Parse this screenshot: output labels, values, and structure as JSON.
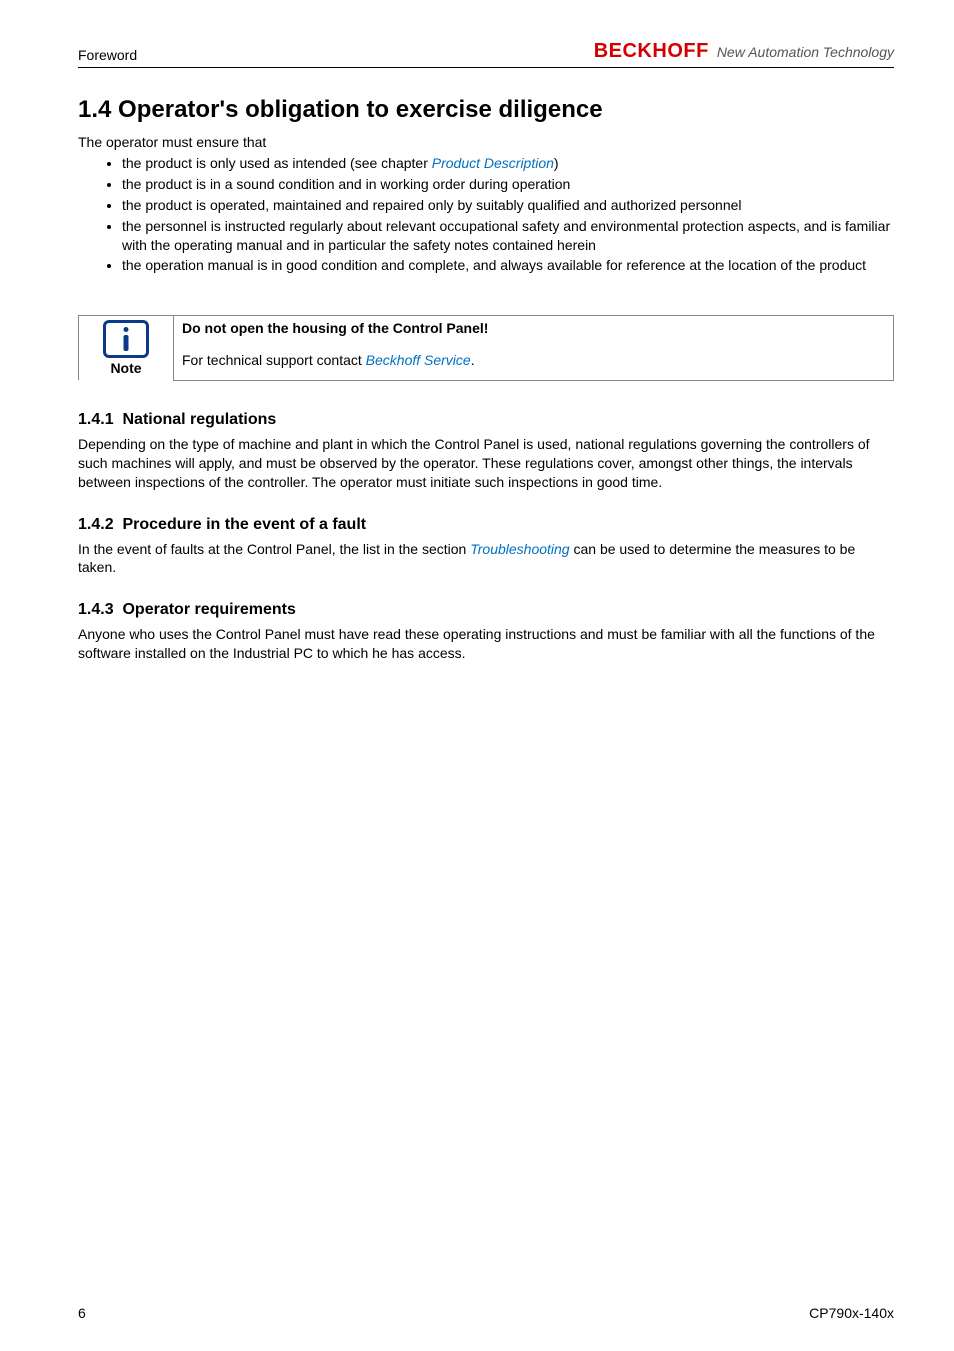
{
  "header": {
    "left": "Foreword",
    "logo": "BECKHOFF",
    "tagline": "New Automation Technology"
  },
  "section": {
    "number": "1.4",
    "title": "Operator's obligation to exercise diligence",
    "intro": "The operator must ensure that",
    "bullets": [
      {
        "pre": "the product is only used as intended (see chapter ",
        "link": "Product Description",
        "post": ")"
      },
      {
        "pre": "the product is in a sound condition and in working order during operation",
        "link": "",
        "post": ""
      },
      {
        "pre": "the product is operated, maintained and repaired only by suitably qualified and authorized personnel",
        "link": "",
        "post": ""
      },
      {
        "pre": "the personnel is instructed regularly about relevant occupational safety and environmental protection aspects, and is familiar with the operating manual and in particular the safety notes contained herein",
        "link": "",
        "post": ""
      },
      {
        "pre": "the operation manual is in good condition and complete, and always available for reference at the location of the product",
        "link": "",
        "post": ""
      }
    ]
  },
  "note": {
    "label": "Note",
    "title": "Do not open the housing of the Control Panel!",
    "body_pre": "For technical support contact ",
    "body_link": "Beckhoff Service",
    "body_post": "."
  },
  "sub1": {
    "num": "1.4.1",
    "title": "National regulations",
    "body": "Depending on the type of machine and plant in which the Control Panel is used, national regulations governing the controllers of such machines will apply, and must be observed by the operator. These regulations cover, amongst other things, the intervals between inspections of the controller. The operator must initiate such inspections in good time."
  },
  "sub2": {
    "num": "1.4.2",
    "title": "Procedure in the event of a fault",
    "body_pre": "In the event of faults at the Control Panel, the list in the section ",
    "body_link": "Troubleshooting",
    "body_post": " can be used to determine the measures to be taken."
  },
  "sub3": {
    "num": "1.4.3",
    "title": "Operator requirements",
    "body": "Anyone who uses the Control Panel must have read these operating instructions and must be familiar with all the functions of the software installed on the Industrial PC to which he has access."
  },
  "footer": {
    "page": "6",
    "doc": "CP790x-140x"
  }
}
